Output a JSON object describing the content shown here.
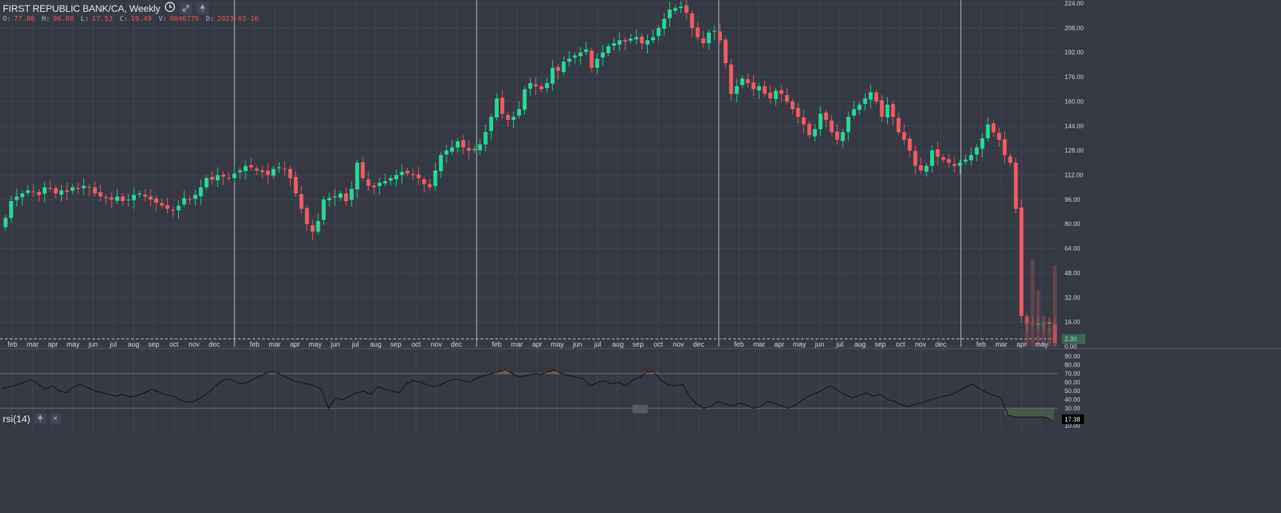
{
  "header": {
    "title": "FIRST REPUBLIC BANK/CA, Weekly",
    "ohlc": [
      {
        "k": "O:",
        "v": "77.80"
      },
      {
        "k": "H:",
        "v": "90.00"
      },
      {
        "k": "L:",
        "v": "17.53"
      },
      {
        "k": "C:",
        "v": "19.49"
      },
      {
        "k": "V:",
        "v": "6046779"
      },
      {
        "k": "D:",
        "v": "2023-03-16"
      }
    ]
  },
  "rsi_panel": {
    "title": "rsi(14)",
    "close_glyph": "×",
    "value_label": "17.38"
  },
  "price_axis": {
    "ticks": [
      "224.00",
      "208.00",
      "192.00",
      "176.00",
      "160.00",
      "144.00",
      "128.00",
      "112.00",
      "96.00",
      "80.00",
      "64.00",
      "48.00",
      "32.00",
      "16.00",
      "0.00"
    ],
    "last_price_label": "2.30"
  },
  "rsi_axis": {
    "ticks": [
      "90.00",
      "80.00",
      "70.00",
      "60.00",
      "50.00",
      "40.00",
      "30.00",
      "20.00",
      "10.00"
    ]
  },
  "time_axis": {
    "labels": [
      "feb",
      "mar",
      "apr",
      "may",
      "jun",
      "jul",
      "aug",
      "sep",
      "oct",
      "nov",
      "dec",
      "feb",
      "mar",
      "apr",
      "may",
      "jun",
      "jul",
      "aug",
      "sep",
      "oct",
      "nov",
      "dec",
      "feb",
      "mar",
      "apr",
      "may",
      "jun",
      "jul",
      "aug",
      "sep",
      "oct",
      "nov",
      "dec",
      "feb",
      "mar",
      "apr",
      "may",
      "jun",
      "jul",
      "aug",
      "sep",
      "oct",
      "nov",
      "dec",
      "feb",
      "mar",
      "apr",
      "may"
    ]
  },
  "colors": {
    "background": "#363a45",
    "up": "#26d996",
    "down": "#ef5b63",
    "grid": "#434751",
    "axis_text": "#d1d4dc"
  },
  "chart_data": {
    "type": "candlestick",
    "title": "FIRST REPUBLIC BANK/CA, Weekly",
    "ylim": [
      0,
      224
    ],
    "rsi_ylim": [
      10,
      90
    ],
    "rsi_levels": [
      70,
      30
    ],
    "weekly_close": [
      84,
      95,
      98,
      100,
      102,
      101,
      99,
      104,
      103,
      100,
      102,
      101,
      104,
      103,
      105,
      104,
      100,
      98,
      97,
      96,
      98,
      95,
      96,
      99,
      100,
      98,
      96,
      94,
      92,
      90,
      89,
      92,
      97,
      96,
      99,
      104,
      110,
      109,
      112,
      111,
      110,
      113,
      115,
      118,
      117,
      115,
      114,
      112,
      116,
      117,
      116,
      110,
      100,
      90,
      80,
      75,
      82,
      96,
      97,
      98,
      100,
      95,
      103,
      120,
      110,
      105,
      104,
      107,
      108,
      110,
      112,
      114,
      113,
      112,
      110,
      106,
      104,
      115,
      125,
      128,
      130,
      134,
      130,
      128,
      129,
      132,
      140,
      150,
      162,
      152,
      148,
      150,
      155,
      168,
      172,
      170,
      168,
      172,
      182,
      180,
      186,
      188,
      190,
      192,
      194,
      182,
      188,
      192,
      196,
      198,
      200,
      199,
      201,
      202,
      198,
      200,
      202,
      208,
      214,
      220,
      221,
      222,
      218,
      208,
      202,
      198,
      205,
      206,
      200,
      185,
      165,
      170,
      175,
      172,
      168,
      170,
      165,
      162,
      167,
      165,
      160,
      155,
      150,
      145,
      138,
      142,
      152,
      148,
      140,
      135,
      140,
      150,
      155,
      158,
      162,
      166,
      160,
      150,
      158,
      150,
      140,
      135,
      128,
      118,
      115,
      118,
      128,
      124,
      122,
      120,
      118,
      120,
      122,
      125,
      130,
      136,
      145,
      140,
      135,
      125,
      120,
      90,
      20,
      15,
      15,
      15,
      15,
      15,
      2.3
    ],
    "rsi": [
      53,
      55,
      57,
      60,
      63,
      58,
      52,
      56,
      50,
      48,
      55,
      58,
      54,
      50,
      48,
      46,
      44,
      46,
      43,
      45,
      48,
      52,
      49,
      46,
      44,
      40,
      37,
      38,
      42,
      48,
      56,
      62,
      64,
      60,
      58,
      62,
      66,
      70,
      72,
      70,
      66,
      62,
      60,
      58,
      56,
      52,
      30,
      42,
      40,
      44,
      48,
      50,
      46,
      55,
      52,
      50,
      48,
      58,
      62,
      60,
      57,
      55,
      58,
      62,
      64,
      62,
      60,
      65,
      68,
      70,
      72,
      75,
      70,
      66,
      68,
      70,
      69,
      72,
      74,
      70,
      68,
      66,
      64,
      56,
      60,
      62,
      58,
      60,
      56,
      63,
      66,
      72,
      72,
      62,
      57,
      56,
      58,
      44,
      35,
      30,
      32,
      38,
      35,
      33,
      36,
      34,
      30,
      32,
      38,
      36,
      33,
      30,
      34,
      40,
      45,
      48,
      52,
      56,
      50,
      46,
      42,
      45,
      48,
      44,
      46,
      40,
      38,
      34,
      32,
      35,
      37,
      40,
      42,
      44,
      46,
      50,
      55,
      58,
      52,
      48,
      45,
      42,
      22,
      20,
      20,
      20,
      20,
      20,
      17.38
    ]
  }
}
